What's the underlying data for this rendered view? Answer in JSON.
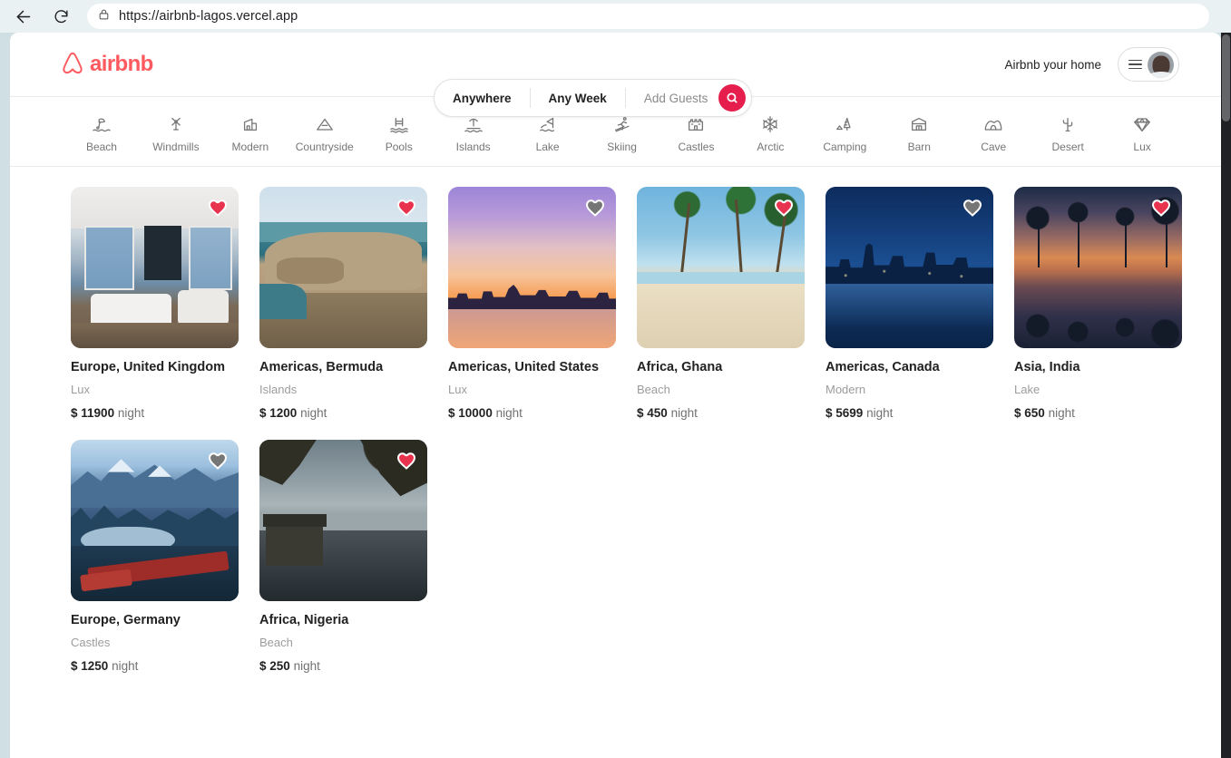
{
  "browser": {
    "url": "https://airbnb-lagos.vercel.app",
    "back_icon": "back-arrow-icon",
    "reload_icon": "reload-icon",
    "lock_icon": "lock-icon"
  },
  "header": {
    "logo_text": "airbnb",
    "search": {
      "location": "Anywhere",
      "dates": "Any Week",
      "guests": "Add Guests",
      "button_icon": "search-icon",
      "accent_color": "#e61e4d"
    },
    "host_link": "Airbnb your home",
    "menu_icon": "hamburger-icon",
    "avatar": "user-avatar"
  },
  "categories": [
    {
      "label": "Beach",
      "icon": "beach-umbrella-icon"
    },
    {
      "label": "Windmills",
      "icon": "windmill-icon"
    },
    {
      "label": "Modern",
      "icon": "modern-house-icon"
    },
    {
      "label": "Countryside",
      "icon": "mountain-icon"
    },
    {
      "label": "Pools",
      "icon": "pool-icon"
    },
    {
      "label": "Islands",
      "icon": "island-palm-icon"
    },
    {
      "label": "Lake",
      "icon": "lake-boat-icon"
    },
    {
      "label": "Skiing",
      "icon": "skier-icon"
    },
    {
      "label": "Castles",
      "icon": "castle-icon"
    },
    {
      "label": "Arctic",
      "icon": "snowflake-icon"
    },
    {
      "label": "Camping",
      "icon": "camping-tree-icon"
    },
    {
      "label": "Barn",
      "icon": "barn-icon"
    },
    {
      "label": "Cave",
      "icon": "cave-icon"
    },
    {
      "label": "Desert",
      "icon": "cactus-icon"
    },
    {
      "label": "Lux",
      "icon": "diamond-icon"
    }
  ],
  "listings": [
    {
      "title": "Europe, United Kingdom",
      "category": "Lux",
      "currency": "$",
      "price": "11900",
      "per": "night",
      "favorited": true,
      "scene": "penthouse-interior"
    },
    {
      "title": "Americas, Bermuda",
      "category": "Islands",
      "currency": "$",
      "price": "1200",
      "per": "night",
      "favorited": true,
      "scene": "coastal-cliffs"
    },
    {
      "title": "Americas, United States",
      "category": "Lux",
      "currency": "$",
      "price": "10000",
      "per": "night",
      "favorited": false,
      "scene": "sunset-skyline"
    },
    {
      "title": "Africa, Ghana",
      "category": "Beach",
      "currency": "$",
      "price": "450",
      "per": "night",
      "favorited": true,
      "scene": "palm-beach"
    },
    {
      "title": "Americas, Canada",
      "category": "Modern",
      "currency": "$",
      "price": "5699",
      "per": "night",
      "favorited": false,
      "scene": "city-night-skyline"
    },
    {
      "title": "Asia, India",
      "category": "Lake",
      "currency": "$",
      "price": "650",
      "per": "night",
      "favorited": true,
      "scene": "palm-sunset-lake"
    },
    {
      "title": "Europe, Germany",
      "category": "Castles",
      "currency": "$",
      "price": "1250",
      "per": "night",
      "favorited": false,
      "scene": "winter-mountain-train"
    },
    {
      "title": "Africa, Nigeria",
      "category": "Beach",
      "currency": "$",
      "price": "250",
      "per": "night",
      "favorited": true,
      "scene": "dusk-shoreline"
    }
  ],
  "colors": {
    "brand": "#ff5a5f",
    "heart_active": "#e8334f",
    "heart_inactive": "#767676"
  }
}
